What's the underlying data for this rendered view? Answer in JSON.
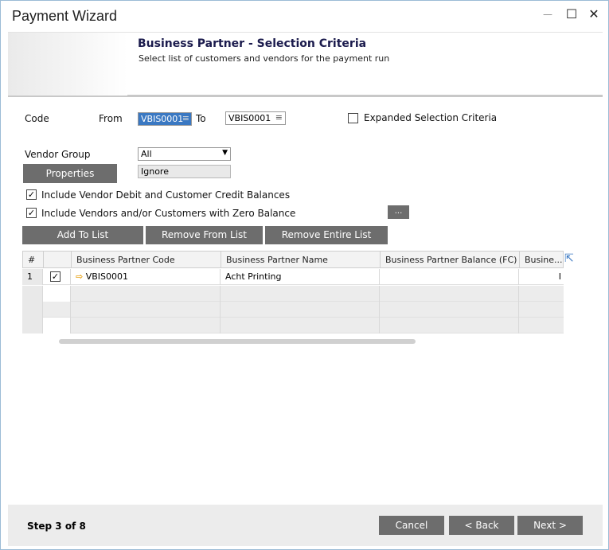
{
  "window": {
    "title": "Payment Wizard"
  },
  "banner": {
    "title": "Business Partner - Selection Criteria",
    "subtitle": "Select list of customers and vendors for the payment run"
  },
  "criteria": {
    "code_label": "Code",
    "from_label": "From",
    "from_value": "VBIS0001",
    "to_label": "To",
    "to_value": "VBIS0001",
    "expanded_label": "Expanded Selection Criteria",
    "vendor_group_label": "Vendor Group",
    "vendor_group_value": "All",
    "properties_label": "Properties",
    "properties_value": "Ignore",
    "include_debit_label": "Include Vendor Debit and Customer Credit Balances",
    "include_zero_label": "Include Vendors and/or Customers with Zero Balance",
    "dots_label": "..."
  },
  "actions": {
    "add": "Add To List",
    "remove": "Remove From List",
    "remove_all": "Remove Entire List"
  },
  "table": {
    "columns": [
      "#",
      "",
      "Business Partner Code",
      "Business Partner Name",
      "Business Partner Balance (FC)",
      "Busine..."
    ],
    "rows": [
      {
        "num": "1",
        "checked": "✓",
        "code": "VBIS0001",
        "name": "Acht Printing",
        "balance": "",
        "extra": "I"
      }
    ]
  },
  "footer": {
    "step": "Step 3 of 8",
    "cancel": "Cancel",
    "back": "< Back",
    "next": "Next >"
  },
  "colors": {
    "button": "#6d6d6d",
    "selection": "#3a78c2",
    "arrow": "#e8a317"
  }
}
